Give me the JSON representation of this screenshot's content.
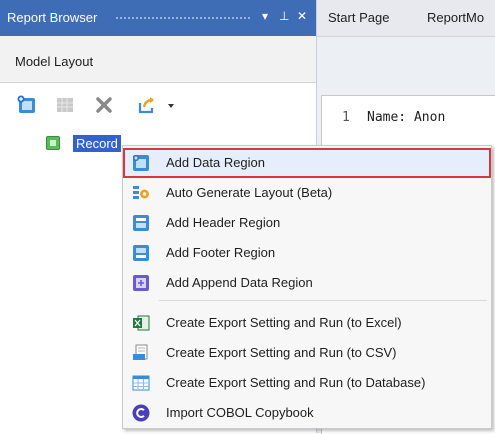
{
  "panel": {
    "title": "Report Browser",
    "controls": {
      "dropdown": "▾",
      "pin": "⊥",
      "close": "✕"
    },
    "model_tab": "Model Layout",
    "tree": {
      "record_label": "Record"
    }
  },
  "doc_tabs": [
    "Start Page",
    "ReportMo"
  ],
  "editor": {
    "line_number": "1",
    "line_text": "Name: Anon"
  },
  "menu": {
    "items": [
      {
        "label": "Add Data Region",
        "icon": "add-data-region-icon"
      },
      {
        "label": "Auto Generate Layout (Beta)",
        "icon": "auto-generate-icon"
      },
      {
        "label": "Add Header Region",
        "icon": "header-region-icon"
      },
      {
        "label": "Add Footer Region",
        "icon": "footer-region-icon"
      },
      {
        "label": "Add Append Data Region",
        "icon": "append-region-icon"
      },
      {
        "label": "Create Export Setting and Run (to Excel)",
        "icon": "excel-icon"
      },
      {
        "label": "Create Export Setting and Run (to CSV)",
        "icon": "csv-icon"
      },
      {
        "label": "Create Export Setting and Run (to Database)",
        "icon": "database-icon"
      },
      {
        "label": "Import COBOL Copybook",
        "icon": "cobol-icon"
      }
    ]
  },
  "colors": {
    "title_bar": "#3e6db5",
    "selection": "#3064c8",
    "highlight_border": "#d9363e"
  }
}
